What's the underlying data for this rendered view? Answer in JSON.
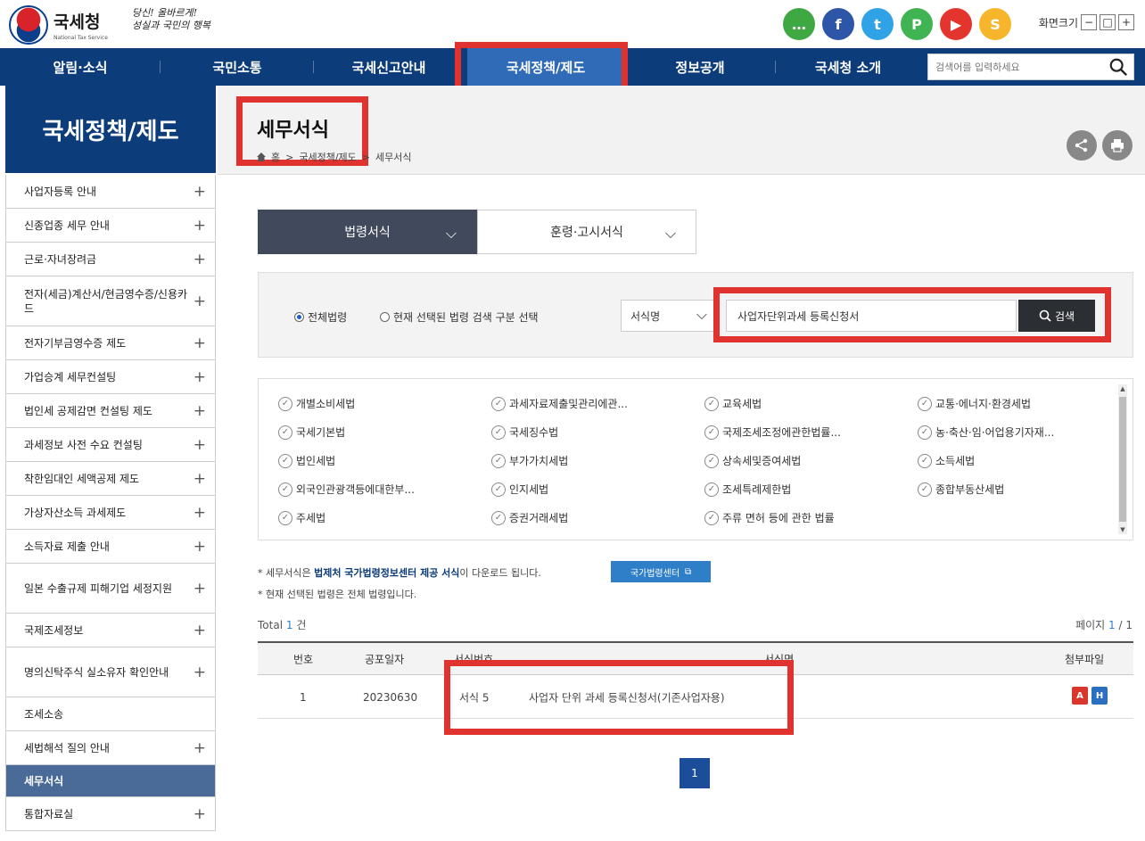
{
  "header": {
    "org_name": "국세청",
    "org_sub": "National Tax Service",
    "slogan_line1": "당신! 올바르게!",
    "slogan_line2": "성실과 국민의 행복",
    "font_size_label": "화면크기",
    "font_size_controls": [
      "−",
      "□",
      "+"
    ]
  },
  "sns": [
    {
      "icon": "chat-icon",
      "glyph": "…",
      "color": "#3ea843"
    },
    {
      "icon": "facebook-icon",
      "glyph": "f",
      "color": "#2d56a8"
    },
    {
      "icon": "twitter-icon",
      "glyph": "t",
      "color": "#30a3e6"
    },
    {
      "icon": "naver-post-icon",
      "glyph": "P",
      "color": "#40b452"
    },
    {
      "icon": "youtube-icon",
      "glyph": "▶",
      "color": "#e3342d"
    },
    {
      "icon": "kakao-story-icon",
      "glyph": "S",
      "color": "#f6b52b"
    }
  ],
  "gnb": {
    "items": [
      "알림·소식",
      "국민소통",
      "국세신고안내",
      "국세정책/제도",
      "정보공개",
      "국세청 소개"
    ],
    "active_index": 3,
    "search_placeholder": "검색어를 입력하세요"
  },
  "sidebar": {
    "title": "국세정책/제도",
    "items": [
      {
        "label": "사업자등록 안내",
        "plus": true
      },
      {
        "label": "신종업종 세무 안내",
        "plus": true
      },
      {
        "label": "근로·자녀장려금",
        "plus": true
      },
      {
        "label": "전자(세금)계산서/현금영수증/신용카드",
        "plus": true
      },
      {
        "label": "전자기부금영수증 제도",
        "plus": true
      },
      {
        "label": "가업승계 세무컨설팅",
        "plus": true
      },
      {
        "label": "법인세 공제감면 컨설팅 제도",
        "plus": true
      },
      {
        "label": "과세정보 사전 수요 컨설팅",
        "plus": true
      },
      {
        "label": "착한임대인 세액공제 제도",
        "plus": true
      },
      {
        "label": "가상자산소득 과세제도",
        "plus": true
      },
      {
        "label": "소득자료 제출 안내",
        "plus": true
      },
      {
        "label": "일본 수출규제 피해기업 세정지원",
        "plus": true
      },
      {
        "label": "국제조세정보",
        "plus": true
      },
      {
        "label": "명의신탁주식 실소유자 확인안내",
        "plus": true
      },
      {
        "label": "조세소송",
        "plus": false
      },
      {
        "label": "세법해석 질의 안내",
        "plus": true
      },
      {
        "label": "세무서식",
        "plus": false,
        "active": true
      },
      {
        "label": "통합자료실",
        "plus": true
      }
    ]
  },
  "page": {
    "title": "세무서식",
    "breadcrumb": [
      "홈",
      "국세정책/제도",
      "세무서식"
    ],
    "share_icon": "share-icon",
    "print_icon": "print-icon"
  },
  "tabs": [
    {
      "label": "법령서식",
      "active": true
    },
    {
      "label": "훈령·고시서식",
      "active": false
    }
  ],
  "search": {
    "radio_all": "전체법령",
    "radio_selected": "현재 선택된 법령 검색 구분 선택",
    "select_value": "서식명",
    "query_value": "사업자단위과세 등록신청서",
    "button_label": "검색"
  },
  "laws": [
    [
      "개별소비세법",
      "과세자료제출및관리에관...",
      "교육세법",
      "교통·에너지·환경세법"
    ],
    [
      "국세기본법",
      "국세징수법",
      "국제조세조정에관한법률...",
      "농·축산·임·어업용기자재..."
    ],
    [
      "법인세법",
      "부가가치세법",
      "상속세및증여세법",
      "소득세법"
    ],
    [
      "외국인관광객등에대한부...",
      "인지세법",
      "조세특례제한법",
      "종합부동산세법"
    ],
    [
      "주세법",
      "증권거래세법",
      "주류 면허 등에 관한 법률",
      ""
    ]
  ],
  "notes": {
    "line1_pre": "* 세무서식은 ",
    "line1_hl": "법제처 국가법령정보센터 제공 서식",
    "line1_post": "이 다운로드 됩니다.",
    "law_center_button": "국가법령센터",
    "line2": "* 현재 선택된 법령은 전체 법령입니다."
  },
  "results": {
    "total_label": "Total",
    "total_count": "1",
    "total_unit": "건",
    "page_label": "페이지",
    "page_current": "1",
    "page_total": "/ 1",
    "columns": [
      "번호",
      "공포일자",
      "서식번호",
      "서식명",
      "첨부파일"
    ],
    "rows": [
      {
        "no": "1",
        "date": "20230630",
        "form_no": "서식 5",
        "form_name": "사업자 단위 과세 등록신청서(기존사업자용)"
      }
    ]
  },
  "pagination": {
    "current": "1"
  },
  "colors": {
    "navy": "#0c3c7a",
    "active_nav": "#2f6bb6",
    "highlight_red": "#e0322e",
    "pdf_red": "#d9372b",
    "hwp_blue": "#2c6fc0"
  }
}
